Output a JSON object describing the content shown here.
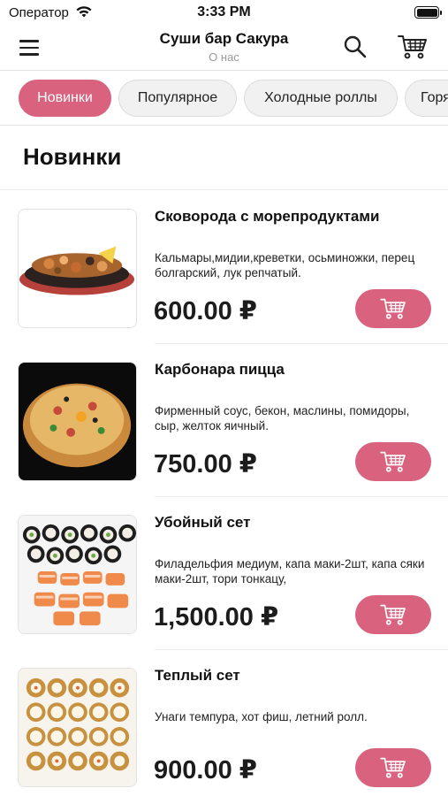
{
  "status_bar": {
    "carrier": "Оператор",
    "time": "3:33 PM"
  },
  "nav": {
    "title": "Суши бар Сакура",
    "subtitle": "О нас"
  },
  "categories": [
    {
      "label": "Новинки",
      "active": true
    },
    {
      "label": "Популярное",
      "active": false
    },
    {
      "label": "Холодные роллы",
      "active": false
    },
    {
      "label": "Горя",
      "active": false
    }
  ],
  "section": {
    "title": "Новинки"
  },
  "items": [
    {
      "name": "Сковорода с морепродуктами",
      "description": "Кальмары,мидии,креветки, осьминожки, перец болгарский, лук репчатый.",
      "price": "600.00 ₽"
    },
    {
      "name": "Карбонара пицца",
      "description": "Фирменный соус, бекон, маслины, помидоры, сыр, желток яичный.",
      "price": "750.00 ₽"
    },
    {
      "name": "Убойный сет",
      "description": "Филадельфия медиум, капа маки-2шт, капа сяки маки-2шт, тори тонкацу,",
      "price": "1,500.00 ₽"
    },
    {
      "name": "Теплый сет",
      "description": "Унаги темпура, хот фиш, летний ролл.",
      "price": "900.00 ₽"
    }
  ],
  "colors": {
    "accent": "#d9627f",
    "chip_bg": "#f1f1f1",
    "divider": "#e3e3e3"
  },
  "icons": {
    "menu": "hamburger-icon",
    "search": "search-icon",
    "cart": "cart-icon",
    "add_to_cart": "cart-icon"
  }
}
